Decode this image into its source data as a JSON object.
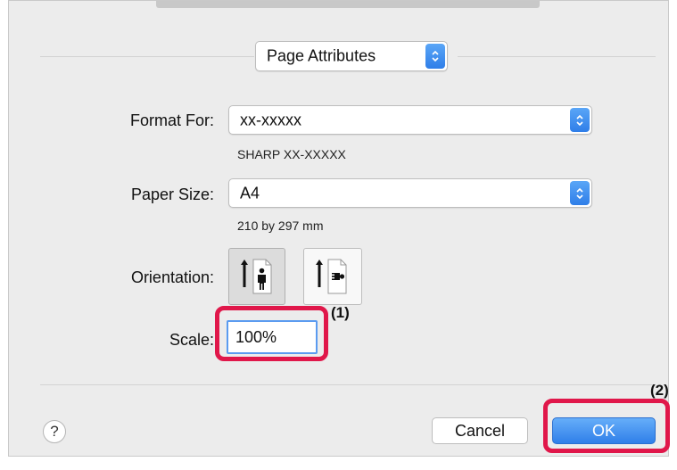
{
  "dialog": {
    "preset_popup": {
      "value": "Page Attributes"
    },
    "format_for": {
      "label": "Format For:",
      "value": "xx-xxxxx",
      "subtext": "SHARP XX-XXXXX"
    },
    "paper_size": {
      "label": "Paper Size:",
      "value": "A4",
      "subtext": "210 by 297 mm"
    },
    "orientation": {
      "label": "Orientation:",
      "options": [
        "portrait",
        "landscape"
      ],
      "selected": "portrait"
    },
    "scale": {
      "label": "Scale:",
      "value": "100%"
    },
    "help": {
      "symbol": "?"
    },
    "buttons": {
      "cancel": "Cancel",
      "ok": "OK"
    }
  },
  "annotations": {
    "callout_1": "(1)",
    "callout_2": "(2)",
    "highlight_color": "#e0174a"
  },
  "colors": {
    "accent": "#2f7fe9",
    "background": "#ececec"
  }
}
